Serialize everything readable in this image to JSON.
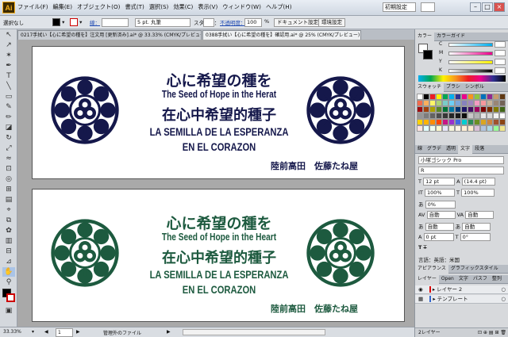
{
  "app": {
    "logo": "Ai"
  },
  "menu": [
    "ファイル(F)",
    "編集(E)",
    "オブジェクト(O)",
    "書式(T)",
    "選択(S)",
    "効果(C)",
    "表示(V)",
    "ウィンドウ(W)",
    "ヘルプ(H)"
  ],
  "workspace": {
    "label": "初期設定"
  },
  "control": {
    "selection": "選択なし",
    "stroke_label": "線：",
    "brush_value": "5 pt. 丸筆",
    "style_label": "スタイル：",
    "opacity_label": "不透明度：",
    "opacity_value": "100",
    "opacity_unit": "%",
    "doc_setup": "ドキュメント設定",
    "prefs": "環境設定"
  },
  "tabs": [
    {
      "label": "0217手拭い【心に希望の種を】注文用 [更新済み].ai* @ 33.33% (CMYK/プレビュー)",
      "active": false
    },
    {
      "label": "0388手拭い【心に希望の種を】確認用.ai* @ 25% (CMYK/プレビュー)",
      "active": true
    }
  ],
  "artboards": [
    {
      "color": "#15184b",
      "line1": "心に希望の種を",
      "line2": "The Seed of Hope in the Herat",
      "line3": "在心中希望的種子",
      "line4": "LA SEMILLA DE LA ESPERANZA",
      "line5": "EN EL CORAZON",
      "signature": "陸前高田　佐藤たね屋"
    },
    {
      "color": "#1d5a3f",
      "line1": "心に希望の種を",
      "line2": "The Seed of Hope in the Heart",
      "line3": "在心中希望的種子",
      "line4": "LA SEMILLA DE LA ESPERANZA",
      "line5": "EN EL CORAZON",
      "signature": "陸前高田　佐藤たね屋"
    }
  ],
  "status": {
    "zoom": "33.33%",
    "page": "1",
    "info": "管理外のファイル"
  },
  "panels": {
    "color_tabs": [
      "カラー",
      "カラーガイド"
    ],
    "color_channels": [
      "C",
      "M",
      "Y",
      "K"
    ],
    "swatch_tabs": [
      "スウォッチ",
      "ブラシ",
      "シンボル"
    ],
    "char_tabs": [
      "線",
      "グラデ",
      "透明",
      "文字",
      "段落"
    ],
    "font_family": "小塚ゴシック Pro",
    "font_style": "R",
    "font_size": "12 pt",
    "leading": "(14.4 pt)",
    "scale_v": "100%",
    "scale_h": "100%",
    "tracking_pct": "0%",
    "kern": "自動",
    "kern2": "自動",
    "baseline": "0 pt",
    "rotate": "0°",
    "language": "言語：英語：米国",
    "appear_tabs": [
      "アピアランス",
      "グラフィックスタイル"
    ],
    "layer_tabs": [
      "レイヤー",
      "Open",
      "文字",
      "パスフ",
      "整列"
    ],
    "layers": [
      "レイヤー 2",
      "テンプレート"
    ],
    "layers_count": "2レイヤー"
  },
  "colors": {
    "ui_bg": "#c8c8c8",
    "artboard_bg": "#ffffff",
    "navy": "#15184b",
    "green": "#1d5a3f"
  }
}
